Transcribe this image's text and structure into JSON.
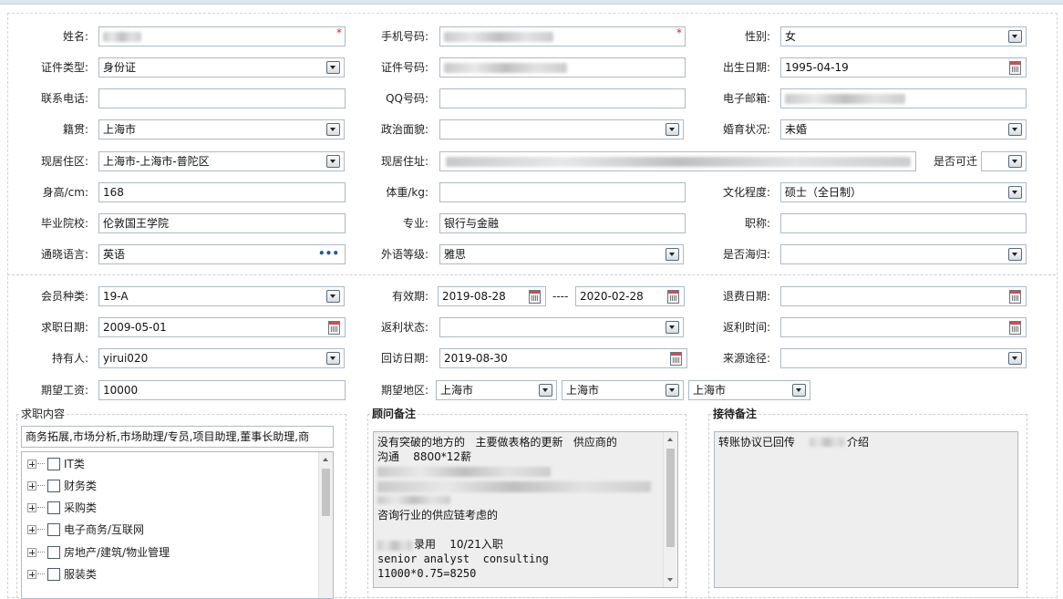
{
  "personal": {
    "name_label": "姓名:",
    "phone_label": "手机号码:",
    "gender_label": "性别:",
    "gender_value": "女",
    "idtype_label": "证件类型:",
    "idtype_value": "身份证",
    "idno_label": "证件号码:",
    "birth_label": "出生日期:",
    "birth_value": "1995-04-19",
    "tel_label": "联系电话:",
    "qq_label": "QQ号码:",
    "email_label": "电子邮箱:",
    "native_label": "籍贯:",
    "native_value": "上海市",
    "political_label": "政治面貌:",
    "marital_label": "婚育状况:",
    "marital_value": "未婚",
    "area_label": "现居住区:",
    "area_value": "上海市-上海市-普陀区",
    "address_label": "现居住址:",
    "relocate_label": "是否可迁",
    "height_label": "身高/cm:",
    "height_value": "168",
    "weight_label": "体重/kg:",
    "edu_label": "文化程度:",
    "edu_value": "硕士（全日制）",
    "school_label": "毕业院校:",
    "school_value": "伦敦国王学院",
    "major_label": "专业:",
    "major_value": "银行与金融",
    "title_label": "职称:",
    "lang_label": "通晓语言:",
    "lang_value": "英语",
    "langlevel_label": "外语等级:",
    "langlevel_value": "雅思",
    "returnee_label": "是否海归:",
    "required_mark": "*"
  },
  "membership": {
    "type_label": "会员种类:",
    "type_value": "19-A",
    "valid_label": "有效期:",
    "valid_from": "2019-08-28",
    "valid_sep": "----",
    "valid_to": "2020-02-28",
    "refund_date_label": "退费日期:",
    "jobdate_label": "求职日期:",
    "jobdate_value": "2009-05-01",
    "rebate_status_label": "返利状态:",
    "rebate_time_label": "返利时间:",
    "holder_label": "持有人:",
    "holder_value": "yirui020",
    "visit_label": "回访日期:",
    "visit_value": "2019-08-30",
    "source_label": "来源途径:",
    "salary_label": "期望工资:",
    "salary_value": "10000",
    "region_label": "期望地区:",
    "region1": "上海市",
    "region2": "上海市",
    "region3": "上海市"
  },
  "job": {
    "title": "求职内容",
    "content": "商务拓展,市场分析,市场助理/专员,项目助理,董事长助理,商",
    "tree": [
      "IT类",
      "财务类",
      "采购类",
      "电子商务/互联网",
      "房地产/建筑/物业管理",
      "服装类"
    ]
  },
  "advisor": {
    "title": "顾问备注",
    "lines": [
      "没有突破的地方的   主要做表格的更新   供应商的",
      "沟通    8800*12薪",
      "",
      "",
      "",
      "咨询行业的供应链考虑的",
      "",
      "录用    10/21入职",
      "senior analyst  consulting",
      "11000*0.75=8250"
    ]
  },
  "reception": {
    "title": "接待备注",
    "text_before": "转账协议已回传",
    "text_after": "介绍"
  },
  "icons": {
    "dropdown": "chevron-down-icon",
    "calendar": "calendar-icon",
    "more": "ellipsis-icon",
    "expand": "plus-box-icon",
    "checkbox": "checkbox-icon"
  }
}
